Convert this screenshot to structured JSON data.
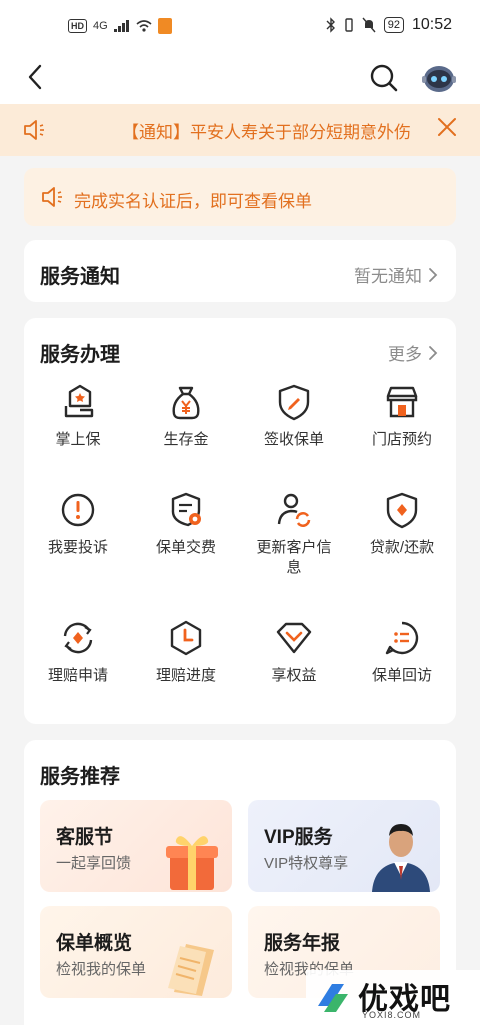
{
  "status_bar": {
    "left_badges": [
      "HD",
      "4G"
    ],
    "time": "10:52",
    "battery": "92"
  },
  "notice": {
    "text": "【通知】平安人寿关于部分短期意外伤"
  },
  "realname": {
    "text": "完成实名认证后，即可查看保单"
  },
  "service_notify": {
    "title": "服务通知",
    "status": "暂无通知"
  },
  "service_handle": {
    "title": "服务办理",
    "more": "更多",
    "items": [
      {
        "label": "掌上保",
        "icon": "hand-house-icon"
      },
      {
        "label": "生存金",
        "icon": "money-bag-icon"
      },
      {
        "label": "签收保单",
        "icon": "shield-pen-icon"
      },
      {
        "label": "门店预约",
        "icon": "store-icon"
      },
      {
        "label": "我要投诉",
        "icon": "exclamation-icon"
      },
      {
        "label": "保单交费",
        "icon": "policy-pay-icon"
      },
      {
        "label": "更新客户信息",
        "icon": "user-refresh-icon"
      },
      {
        "label": "贷款/还款",
        "icon": "shield-diamond-icon"
      },
      {
        "label": "理赔申请",
        "icon": "claim-cycle-icon"
      },
      {
        "label": "理赔进度",
        "icon": "claim-clock-icon"
      },
      {
        "label": "享权益",
        "icon": "diamond-badge-icon"
      },
      {
        "label": "保单回访",
        "icon": "chat-list-icon"
      }
    ]
  },
  "service_recommend": {
    "title": "服务推荐",
    "tiles": [
      {
        "title": "客服节",
        "subtitle": "一起享回馈"
      },
      {
        "title": "VIP服务",
        "subtitle": "VIP特权尊享"
      },
      {
        "title": "保单概览",
        "subtitle": "检视我的保单"
      },
      {
        "title": "服务年报",
        "subtitle": "检视我的保单"
      }
    ]
  },
  "watermark": {
    "text": "优戏吧",
    "url": "YOXI8.COM"
  },
  "colors": {
    "accent": "#e2701f",
    "icon": "#2a2a2a",
    "icon_accent": "#f0621e"
  }
}
